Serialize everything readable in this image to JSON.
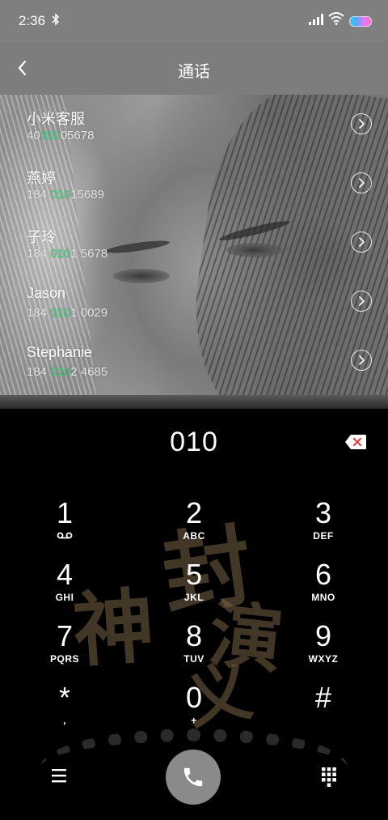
{
  "status_bar": {
    "time": "2:36"
  },
  "header": {
    "title": "通话"
  },
  "contacts": [
    {
      "name": "小米客服",
      "number_before": "40",
      "number_match": "010",
      "number_after": "05678"
    },
    {
      "name": "燕婷",
      "number_before": "184 ",
      "number_match": "010",
      "number_after": "15689"
    },
    {
      "name": "子玲",
      "number_before": "184 ",
      "number_match": "010",
      "number_after": "1 5678"
    },
    {
      "name": "Jason",
      "number_before": "184 ",
      "number_match": "010",
      "number_after": "1 0029"
    },
    {
      "name": "Stephanie",
      "number_before": "184 ",
      "number_match": "010",
      "number_after": "2 4685"
    }
  ],
  "dialpad": {
    "entered_number": "010",
    "keys": [
      {
        "digit": "1",
        "letters": ""
      },
      {
        "digit": "2",
        "letters": "ABC"
      },
      {
        "digit": "3",
        "letters": "DEF"
      },
      {
        "digit": "4",
        "letters": "GHI"
      },
      {
        "digit": "5",
        "letters": "JKL"
      },
      {
        "digit": "6",
        "letters": "MNO"
      },
      {
        "digit": "7",
        "letters": "PQRS"
      },
      {
        "digit": "8",
        "letters": "TUV"
      },
      {
        "digit": "9",
        "letters": "WXYZ"
      },
      {
        "digit": "*",
        "letters": ","
      },
      {
        "digit": "0",
        "letters": "+"
      },
      {
        "digit": "#",
        "letters": ""
      }
    ]
  },
  "theme": {
    "match_highlight": "#39d47a",
    "call_button": "#8a8a8a"
  },
  "icons": {
    "back": "chevron-left-icon",
    "detail": "chevron-right-circle-icon",
    "delete": "backspace-icon",
    "menu": "hamburger-menu-icon",
    "call": "phone-icon",
    "keypad": "keypad-icon",
    "voicemail": "voicemail-icon"
  }
}
